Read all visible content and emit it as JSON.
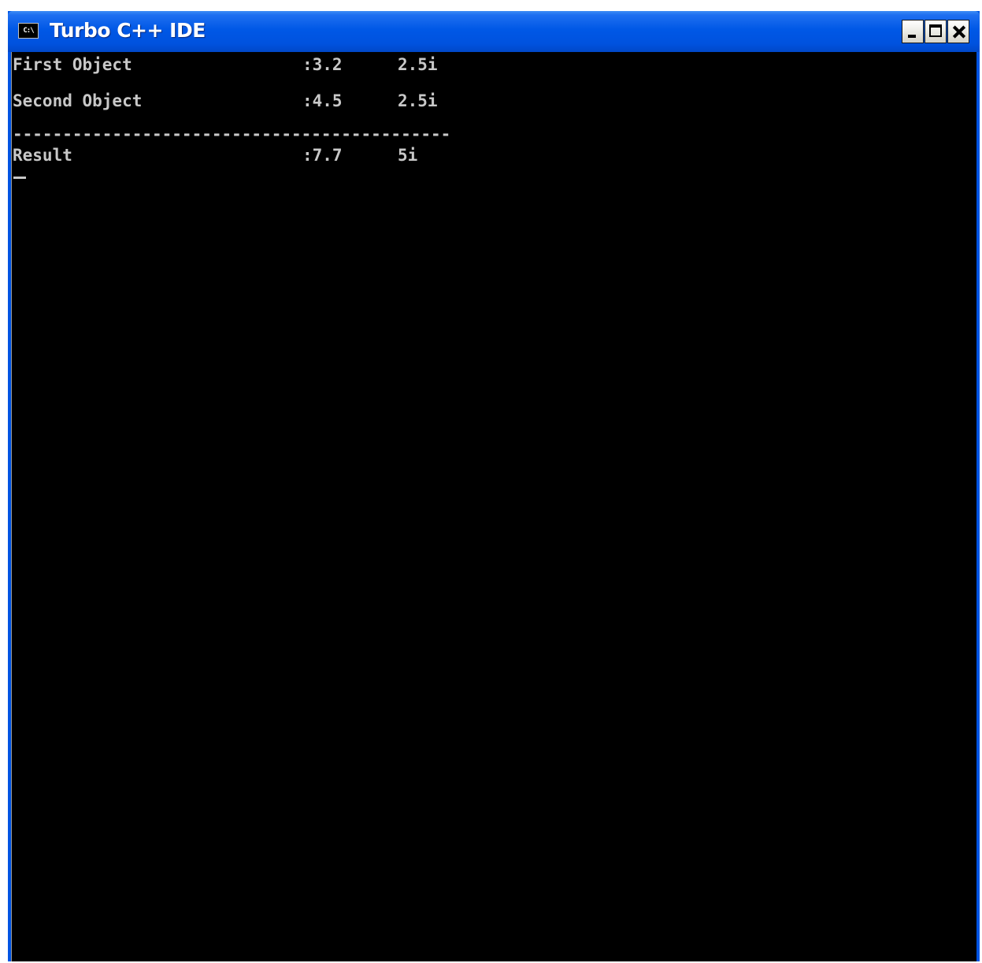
{
  "window": {
    "title": "Turbo C++ IDE",
    "icon_text": "C:\\",
    "icon_name": "console-app-icon",
    "buttons": {
      "minimize": "minimize-icon",
      "maximize": "maximize-icon",
      "close": "close-icon"
    }
  },
  "console": {
    "rows": [
      {
        "label": "First Object",
        "real": ":3.2",
        "imag": "2.5i"
      },
      {
        "label": "Second Object",
        "real": ":4.5",
        "imag": "2.5i"
      }
    ],
    "separator": "--------------------------------------------",
    "result": {
      "label": "Result",
      "real": ":7.7",
      "imag": "5i"
    }
  },
  "colors": {
    "titlebar": "#0054e3",
    "console_bg": "#000000",
    "console_text": "#c8c8c8"
  }
}
